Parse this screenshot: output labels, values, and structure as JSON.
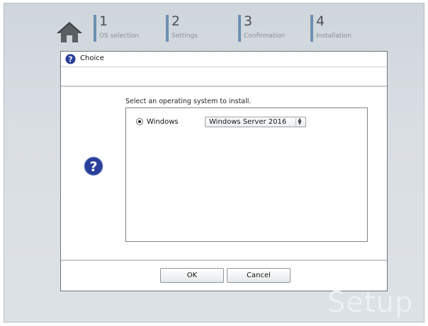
{
  "nav": {
    "home_icon": "home-icon",
    "steps": [
      {
        "number": "1",
        "label": "OS selection"
      },
      {
        "number": "2",
        "label": "Settings"
      },
      {
        "number": "3",
        "label": "Confirmation"
      },
      {
        "number": "4",
        "label": "Installation"
      }
    ],
    "step_bar_color": "#6e8fb0"
  },
  "dialog": {
    "title": "Choice",
    "title_icon": "question-icon",
    "prompt": "Select an operating system to install.",
    "option": {
      "label": "Windows",
      "selected": true,
      "select_value": "Windows Server 2016"
    },
    "ok_label": "OK",
    "cancel_label": "Cancel",
    "accent_color": "#2a3f9a"
  },
  "watermark": "Setup"
}
